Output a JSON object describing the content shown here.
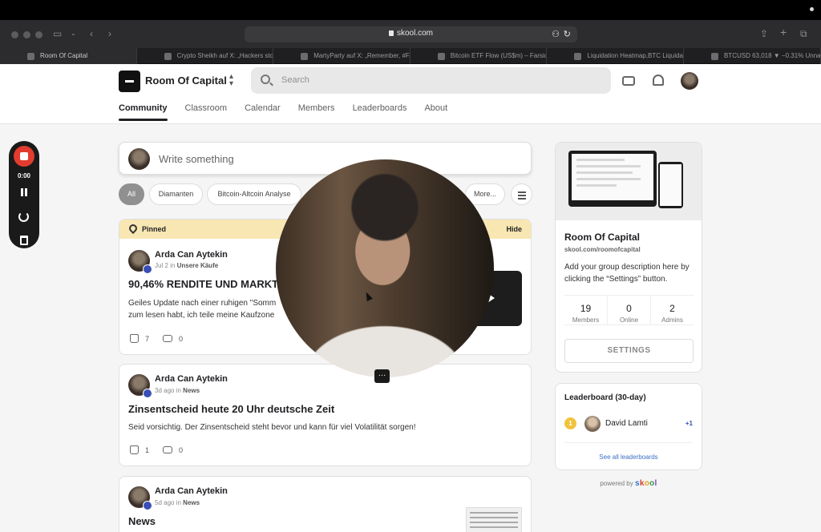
{
  "browser": {
    "url": "skool.com",
    "tabs": [
      {
        "label": "Room Of Capital"
      },
      {
        "label": "Crypto Sheikh auf X: „Hackers sto..."
      },
      {
        "label": "MartyParty auf X: „Remember, #F..."
      },
      {
        "label": "Bitcoin ETF Flow (US$m) – Farsid..."
      },
      {
        "label": "Liquidation Heatmap,BTC Liquida..."
      },
      {
        "label": "BTCUSD 63,018 ▼ −0.31% Unnam..."
      }
    ]
  },
  "header": {
    "group_name": "Room Of Capital",
    "search_placeholder": "Search",
    "nav": [
      {
        "label": "Community"
      },
      {
        "label": "Classroom"
      },
      {
        "label": "Calendar"
      },
      {
        "label": "Members"
      },
      {
        "label": "Leaderboards"
      },
      {
        "label": "About"
      }
    ]
  },
  "recorder": {
    "time": "0:00"
  },
  "composer": {
    "placeholder": "Write something"
  },
  "filters": [
    {
      "label": "All"
    },
    {
      "label": "Diamanten"
    },
    {
      "label": "Bitcoin-Altcoin Analyse"
    },
    {
      "label": "More..."
    }
  ],
  "posts": [
    {
      "pinned_label": "Pinned",
      "hide_label": "Hide",
      "author": "Arda Can Aytekin",
      "time": "Jul 2",
      "category": "Unsere Käufe",
      "title": "90,46% RENDITE UND MARKTE",
      "body_line1": "Geiles Update nach einer ruhigen \"Somm",
      "body_line2": "zum lesen habt, ich teile meine Kaufzone",
      "likes": "7",
      "comments": "0"
    },
    {
      "author": "Arda Can Aytekin",
      "time": "3d ago",
      "category": "News",
      "title": "Zinsentscheid heute 20 Uhr deutsche Zeit",
      "body_line1": "Seid vorsichtig. Der Zinsentscheid steht bevor und kann für viel Volatilität sorgen!",
      "likes": "1",
      "comments": "0"
    },
    {
      "author": "Arda Can Aytekin",
      "time": "5d ago",
      "category": "News",
      "title": "News"
    }
  ],
  "meta_in": "in",
  "sidebar": {
    "name": "Room Of Capital",
    "url": "skool.com/roomofcapital",
    "description": "Add your group description here by clicking the “Settings” button.",
    "stats": [
      {
        "value": "19",
        "label": "Members"
      },
      {
        "value": "0",
        "label": "Online"
      },
      {
        "value": "2",
        "label": "Admins"
      }
    ],
    "settings_label": "SETTINGS"
  },
  "leaderboard": {
    "title": "Leaderboard (30-day)",
    "rank": "1",
    "name": "David Lamti",
    "points": "+1",
    "link": "See all leaderboards"
  },
  "powered": {
    "prefix": "powered by",
    "brand": [
      "s",
      "k",
      "o",
      "o",
      "l"
    ]
  },
  "colors": {
    "accent_blue": "#3a4eb6",
    "record_red": "#e23c2f",
    "pinned_bg": "#f8e7b2"
  }
}
